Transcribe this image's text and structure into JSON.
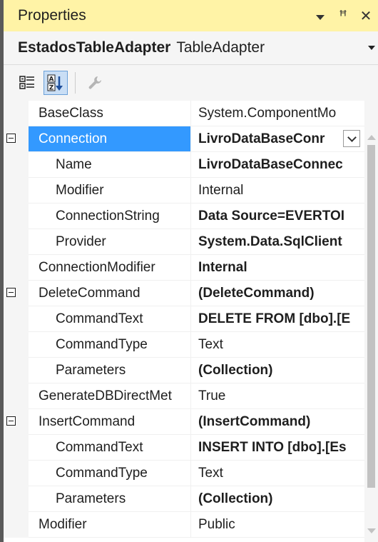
{
  "panel": {
    "title": "Properties",
    "controls": {
      "dropdown_icon": "dropdown-arrow-icon",
      "pin_glyph": "ꟸ",
      "close_glyph": "✕"
    }
  },
  "object_selector": {
    "name": "EstadosTableAdapter",
    "type": "TableAdapter"
  },
  "toolbar": {
    "buttons": [
      {
        "name": "categorized-icon",
        "active": false
      },
      {
        "name": "alphabetical-icon",
        "active": true
      },
      {
        "name": "property-pages-icon",
        "active": false
      }
    ]
  },
  "colors": {
    "title_bar": "#fff3a6",
    "selection": "#3399ff",
    "gutter": "#f5f5f5"
  },
  "properties": [
    {
      "name": "BaseClass",
      "value": "System.ComponentMo",
      "level": 0,
      "expander": false,
      "bold": false,
      "selected": false
    },
    {
      "name": "Connection",
      "value": "LivroDataBaseConr",
      "level": 0,
      "expander": true,
      "bold": true,
      "selected": true,
      "dropdown": true
    },
    {
      "name": "Name",
      "value": "LivroDataBaseConnec",
      "level": 1,
      "expander": false,
      "bold": true,
      "selected": false
    },
    {
      "name": "Modifier",
      "value": "Internal",
      "level": 1,
      "expander": false,
      "bold": false,
      "selected": false
    },
    {
      "name": "ConnectionString",
      "value": "Data Source=EVERTOI",
      "level": 1,
      "expander": false,
      "bold": true,
      "selected": false
    },
    {
      "name": "Provider",
      "value": "System.Data.SqlClient",
      "level": 1,
      "expander": false,
      "bold": true,
      "selected": false
    },
    {
      "name": "ConnectionModifier",
      "value": "Internal",
      "level": 0,
      "expander": false,
      "bold": true,
      "selected": false
    },
    {
      "name": "DeleteCommand",
      "value": "(DeleteCommand)",
      "level": 0,
      "expander": true,
      "bold": true,
      "selected": false
    },
    {
      "name": "CommandText",
      "value": "DELETE FROM [dbo].[E",
      "level": 1,
      "expander": false,
      "bold": true,
      "selected": false
    },
    {
      "name": "CommandType",
      "value": "Text",
      "level": 1,
      "expander": false,
      "bold": false,
      "selected": false
    },
    {
      "name": "Parameters",
      "value": "(Collection)",
      "level": 1,
      "expander": false,
      "bold": true,
      "selected": false
    },
    {
      "name": "GenerateDBDirectMet",
      "value": "True",
      "level": 0,
      "expander": false,
      "bold": false,
      "selected": false
    },
    {
      "name": "InsertCommand",
      "value": "(InsertCommand)",
      "level": 0,
      "expander": true,
      "bold": true,
      "selected": false
    },
    {
      "name": "CommandText",
      "value": "INSERT INTO [dbo].[Es",
      "level": 1,
      "expander": false,
      "bold": true,
      "selected": false
    },
    {
      "name": "CommandType",
      "value": "Text",
      "level": 1,
      "expander": false,
      "bold": false,
      "selected": false
    },
    {
      "name": "Parameters",
      "value": "(Collection)",
      "level": 1,
      "expander": false,
      "bold": true,
      "selected": false
    },
    {
      "name": "Modifier",
      "value": "Public",
      "level": 0,
      "expander": false,
      "bold": false,
      "selected": false
    }
  ]
}
